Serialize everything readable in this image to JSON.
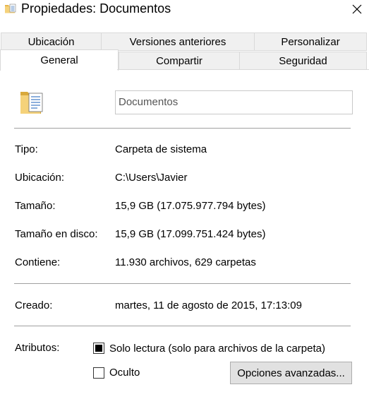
{
  "window": {
    "title": "Propiedades: Documentos",
    "close_glyph": "✕"
  },
  "tabs": {
    "row1": [
      "Ubicación",
      "Versiones anteriores",
      "Personalizar"
    ],
    "row2": [
      "General",
      "Compartir",
      "Seguridad"
    ],
    "active": "General"
  },
  "general": {
    "folder_name": "Documentos",
    "properties": [
      {
        "label": "Tipo:",
        "value": "Carpeta de sistema"
      },
      {
        "label": "Ubicación:",
        "value": "C:\\Users\\Javier"
      },
      {
        "label": "Tamaño:",
        "value": "15,9 GB (17.075.977.794 bytes)"
      },
      {
        "label": "Tamaño en disco:",
        "value": "15,9 GB (17.099.751.424 bytes)"
      },
      {
        "label": "Contiene:",
        "value": "11.930 archivos, 629 carpetas"
      }
    ],
    "created_label": "Creado:",
    "created_value": "martes, 11 de agosto de 2015, 17:13:09",
    "attributes_label": "Atributos:",
    "readonly_label": "Solo lectura (solo para archivos de la carpeta)",
    "readonly_state": "indeterminate",
    "hidden_label": "Oculto",
    "hidden_checked": false,
    "advanced_button": "Opciones avanzadas..."
  },
  "icons": {
    "title_icon": "folder-document-icon",
    "folder_icon": "folder-document-icon",
    "close_icon": "close-icon"
  },
  "colors": {
    "tab_bg": "#f0f0f0",
    "border": "#d9d9d9",
    "button_bg": "#e1e1e1",
    "folder_yellow": "#f2c55c"
  }
}
